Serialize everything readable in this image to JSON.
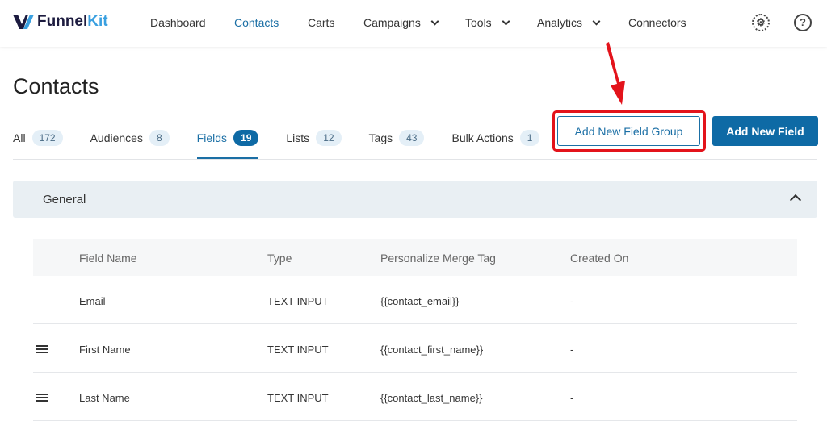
{
  "brand": {
    "name_a": "Funnel",
    "name_b": "Kit"
  },
  "nav": [
    {
      "label": "Dashboard"
    },
    {
      "label": "Contacts",
      "active": true
    },
    {
      "label": "Carts"
    },
    {
      "label": "Campaigns",
      "dropdown": true
    },
    {
      "label": "Tools",
      "dropdown": true
    },
    {
      "label": "Analytics",
      "dropdown": true
    },
    {
      "label": "Connectors"
    }
  ],
  "icons": {
    "settings": "gear-icon",
    "help": "help-icon"
  },
  "page_title": "Contacts",
  "tabs": [
    {
      "label": "All",
      "count": "172"
    },
    {
      "label": "Audiences",
      "count": "8"
    },
    {
      "label": "Fields",
      "count": "19",
      "active": true
    },
    {
      "label": "Lists",
      "count": "12"
    },
    {
      "label": "Tags",
      "count": "43"
    },
    {
      "label": "Bulk Actions",
      "count": "1"
    }
  ],
  "buttons": {
    "add_group": "Add New Field Group",
    "add_field": "Add New Field"
  },
  "section": {
    "title": "General"
  },
  "table": {
    "headers": [
      "Field Name",
      "Type",
      "Personalize Merge Tag",
      "Created On"
    ],
    "rows": [
      {
        "name": "Email",
        "type": "TEXT INPUT",
        "tag": "{{contact_email}}",
        "created": "-",
        "draggable": false
      },
      {
        "name": "First Name",
        "type": "TEXT INPUT",
        "tag": "{{contact_first_name}}",
        "created": "-",
        "draggable": true
      },
      {
        "name": "Last Name",
        "type": "TEXT INPUT",
        "tag": "{{contact_last_name}}",
        "created": "-",
        "draggable": true
      }
    ]
  },
  "colors": {
    "accent": "#0e6aa5",
    "highlight": "#e3131b"
  }
}
